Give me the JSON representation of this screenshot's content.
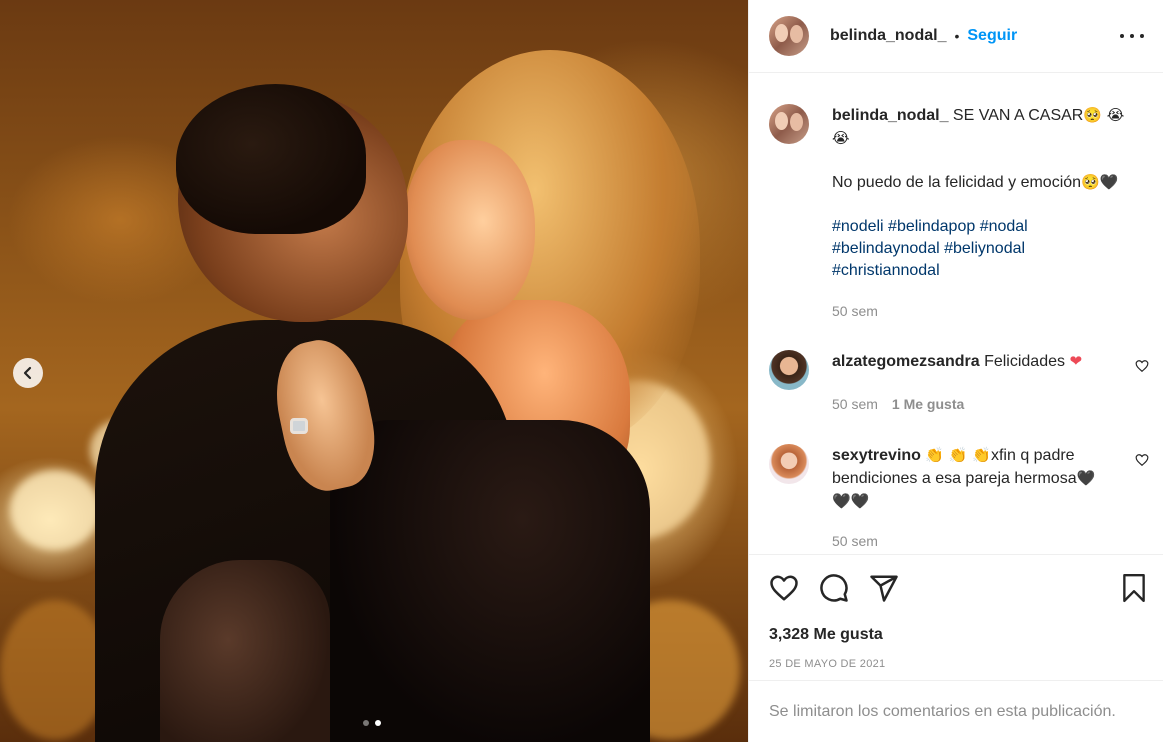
{
  "post": {
    "username": "belinda_nodal_",
    "separator": "•",
    "follow_label": "Seguir",
    "carousel": {
      "dots": 2,
      "active_index": 1
    }
  },
  "caption": {
    "username": "belinda_nodal_",
    "line1": "SE VAN A CASAR",
    "line1_emoji": "🥺 😭",
    "line2_emoji": "😭",
    "line3": "No puedo de la felicidad y emoción",
    "line3_emoji": "🥺🖤",
    "hashtags_1": "#nodeli #belindapop #nodal",
    "hashtags_2": "#belindaynodal #beliynodal",
    "hashtags_3": "#christiannodal",
    "time": "50 sem"
  },
  "comments": [
    {
      "username": "alzategomezsandra",
      "text": "Felicidades",
      "emoji": "❤",
      "time": "50 sem",
      "likes": "1 Me gusta"
    },
    {
      "username": "sexytrevino",
      "emoji_lead": "👏 👏 👏",
      "text_1": "xfin q padre",
      "text_2": "bendiciones a esa pareja hermosa",
      "emoji_trail_1": "🖤",
      "emoji_trail_2": "🖤🖤",
      "time": "50 sem"
    }
  ],
  "likes_count": "3,328 Me gusta",
  "date": "25 DE MAYO DE 2021",
  "comments_limited": "Se limitaron los comentarios en esta publicación.",
  "colors": {
    "accent": "#0095f6",
    "text": "#262626",
    "muted": "#8e8e8e",
    "heart": "#ed4956"
  },
  "icons": [
    "chevron-left-icon",
    "more-icon",
    "heart-icon",
    "comment-icon",
    "share-icon",
    "bookmark-icon"
  ]
}
